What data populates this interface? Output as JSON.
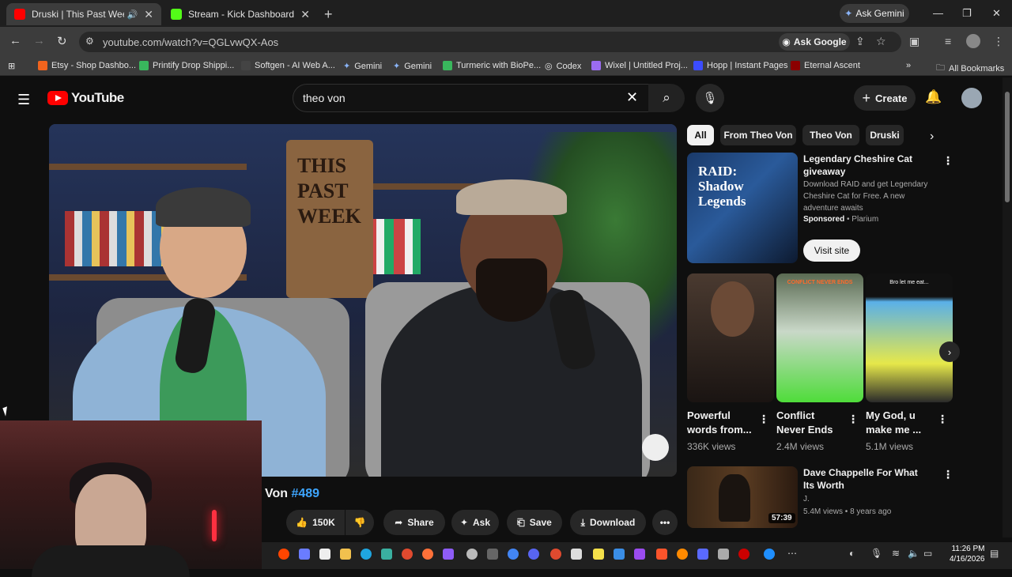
{
  "browser": {
    "tabs": [
      {
        "title": "Druski | This Past Weekend",
        "active": true
      },
      {
        "title": "Stream - Kick Dashboard",
        "active": false
      }
    ],
    "ask_gemini": "Ask Gemini",
    "url": "youtube.com/watch?v=QGLvwQX-Aos",
    "ask_google": "Ask Google",
    "bookmarks": [
      "Etsy - Shop Dashbo...",
      "Printify Drop Shippi...",
      "Softgen - AI Web A...",
      "Gemini",
      "Gemini",
      "Turmeric with BioPe...",
      "Codex",
      "Wixel | Untitled Proj...",
      "Hopp | Instant Pages",
      "Eternal Ascent"
    ],
    "all_bookmarks": "All Bookmarks",
    "more_bookmarks": "»"
  },
  "youtube": {
    "logo_text": "YouTube",
    "search_value": "theo von",
    "create_label": "Create"
  },
  "video": {
    "sign_line1": "THIS",
    "sign_line2": "PAST",
    "sign_line3": "WEEK",
    "title_prefix": "Von ",
    "title_tag": "#489",
    "actions": {
      "likes": "150K",
      "share": "Share",
      "ask": "Ask",
      "save": "Save",
      "download": "Download"
    }
  },
  "sidebar": {
    "chips": [
      "All",
      "From Theo Von",
      "Theo Von",
      "Druski"
    ],
    "ad": {
      "image_text": "RAID: Shadow Legends",
      "title": "Legendary Cheshire Cat giveaway",
      "description": "Download RAID and get Legendary Cheshire Cat for Free. A new adventure awaits",
      "sponsored": "Sponsored",
      "advertiser": "Plarium",
      "button": "Visit site"
    },
    "shorts": [
      {
        "title": "Powerful words from...",
        "views": "336K views"
      },
      {
        "title": "Conflict Never Ends",
        "views": "2.4M views",
        "thumb_text": "CONFLICT NEVER ENDS"
      },
      {
        "title": "My God, u make me ...",
        "views": "5.1M views",
        "thumb_text": "Bro let me eat..."
      }
    ],
    "recommended": {
      "title": "Dave Chappelle For What Its Worth",
      "channel": "J.",
      "meta": "5.4M views • 8 years ago",
      "duration": "57:39"
    }
  },
  "taskbar": {
    "time": "11:26 PM",
    "date": "4/16/2026"
  },
  "colors": {
    "accent_link": "#3ea6ff",
    "yt_red": "#ff0000",
    "background": "#0f0f0f"
  }
}
